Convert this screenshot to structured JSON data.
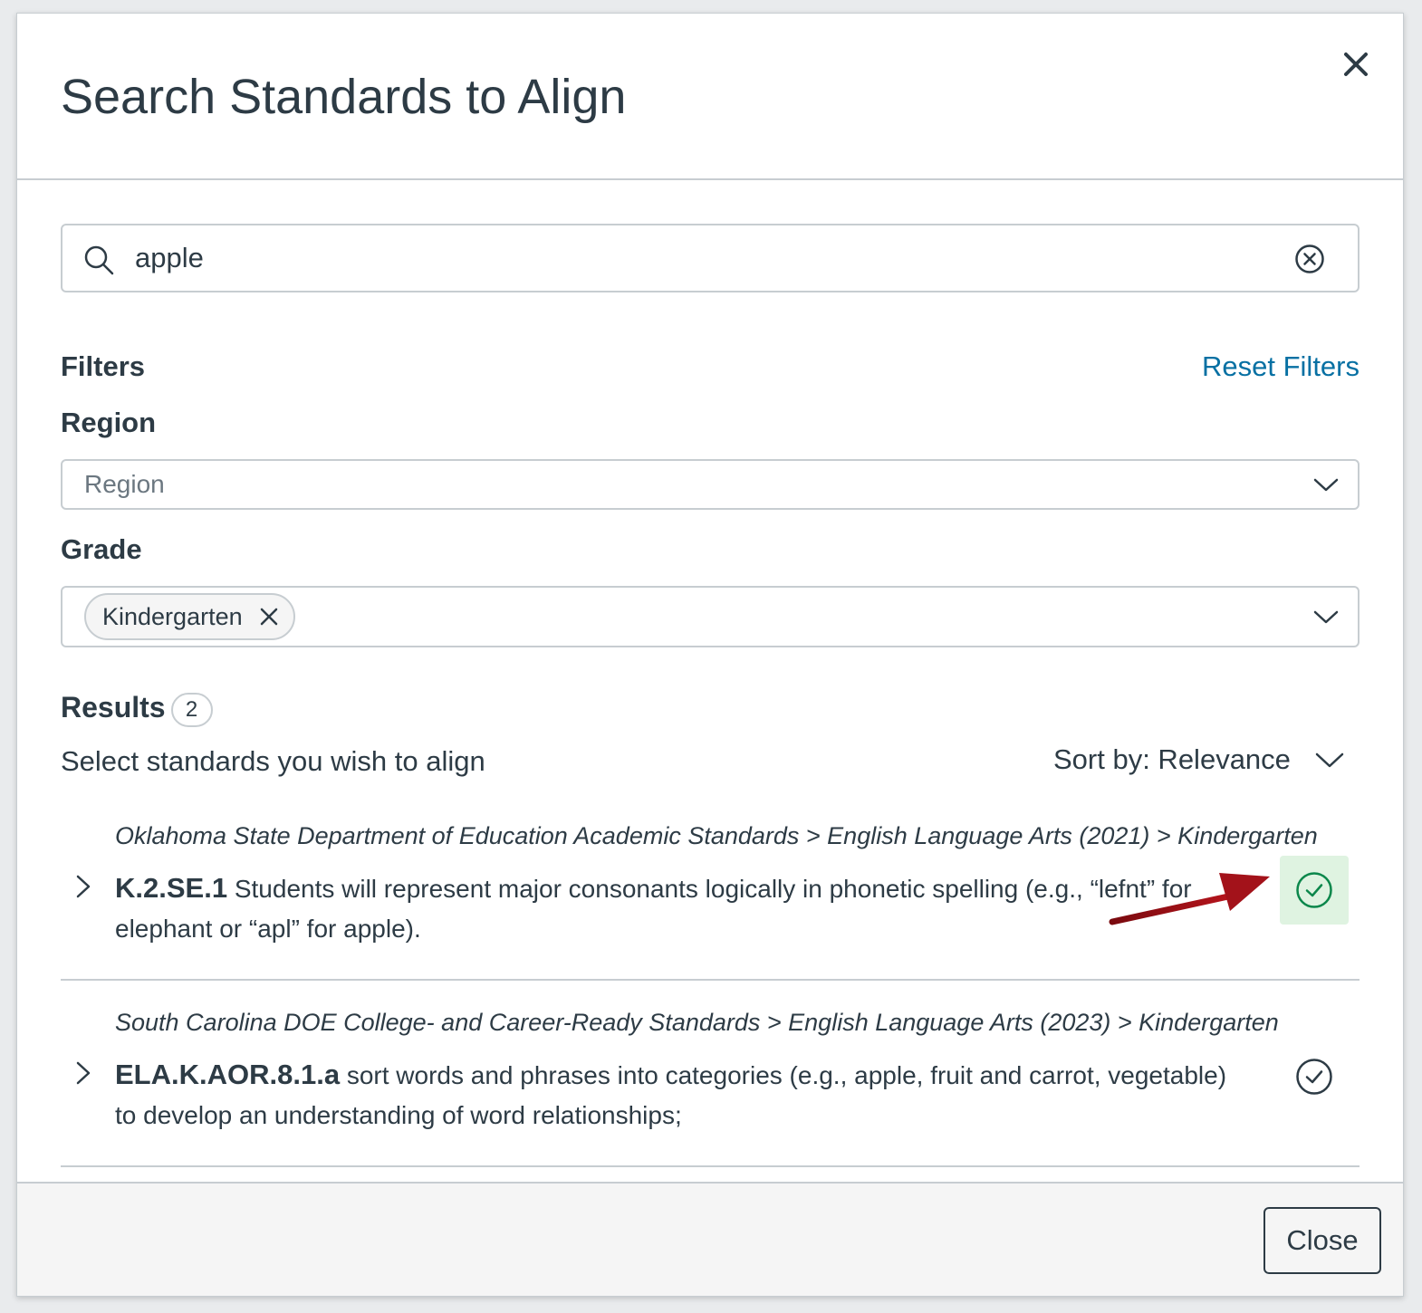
{
  "modal": {
    "title": "Search Standards to Align"
  },
  "search": {
    "value": "apple",
    "placeholder": ""
  },
  "filters": {
    "label": "Filters",
    "reset_label": "Reset Filters",
    "region": {
      "label": "Region",
      "placeholder": "Region"
    },
    "grade": {
      "label": "Grade",
      "selected_tags": [
        "Kindergarten"
      ]
    }
  },
  "results": {
    "label": "Results",
    "count": "2",
    "prompt": "Select standards you wish to align",
    "sort_label": "Sort by: Relevance",
    "items": [
      {
        "breadcrumb": "Oklahoma State Department of Education Academic Standards > English Language Arts (2021) > Kindergarten",
        "code": "K.2.SE.1",
        "description": " Students will represent major consonants logically in phonetic spelling (e.g., “lefnt” for elephant or “apl” for apple).",
        "selected": true
      },
      {
        "breadcrumb": "South Carolina DOE College- and Career-Ready Standards > English Language Arts (2023) > Kindergarten",
        "code": "ELA.K.AOR.8.1.a",
        "description": " sort words and phrases into categories (e.g., apple, fruit and carrot, vegetable) to develop an understanding of word relationships;",
        "selected": false
      }
    ]
  },
  "footer": {
    "close_label": "Close"
  },
  "colors": {
    "text": "#2d3b45",
    "link": "#0770a3",
    "border": "#c7cdd1",
    "success": "#0b874b",
    "success_bg": "#dff3e1",
    "annotation_arrow": "#9b1016"
  },
  "icons": {
    "close": "close-icon",
    "search": "search-icon",
    "clear": "clear-circle-icon",
    "dropdown": "chevron-down-icon",
    "expand": "chevron-right-icon",
    "align": "check-circle-icon"
  }
}
